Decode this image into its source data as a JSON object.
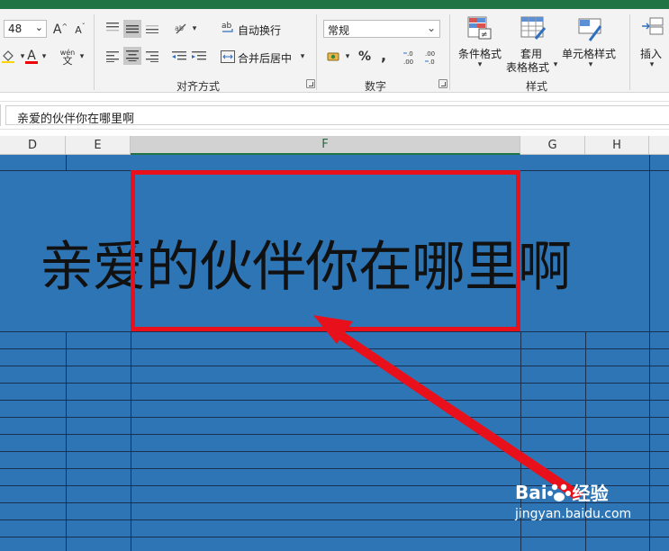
{
  "ribbon": {
    "font_size": "48",
    "font_size_caret": "⌄",
    "grow_font": "A",
    "shrink_font": "A",
    "pinyin_label": "wén",
    "font_color_icon": "A",
    "alignment": {
      "group_label": "对齐方式",
      "wrap_text": "自动换行",
      "merge_center": "合并后居中",
      "wrap_icon": "ab",
      "dropdown": "▾"
    },
    "number": {
      "group_label": "数字",
      "format_value": "常规",
      "format_caret": "⌄",
      "percent": "%",
      "comma": ",",
      "inc_decimal": "←.0\n.00",
      "dec_decimal": ".00\n→.0"
    },
    "styles": {
      "group_label": "样式",
      "conditional": "条件格式",
      "table_format_line1": "套用",
      "table_format_line2": "表格格式",
      "cell_styles": "单元格样式",
      "dropdown": "▾"
    },
    "cells": {
      "insert": "插入"
    }
  },
  "formula_bar": {
    "content": "亲爱的伙伴你在哪里啊"
  },
  "columns": [
    "D",
    "E",
    "F",
    "G",
    "H"
  ],
  "cell": {
    "text": "亲爱的伙伴你在哪里啊"
  },
  "watermark": {
    "brand": "Bai",
    "brand2": "经验",
    "url": "jingyan.baidu.com"
  },
  "colors": {
    "fill": "#2e75b6",
    "highlight": "#e8101a",
    "excel_green": "#217346"
  }
}
